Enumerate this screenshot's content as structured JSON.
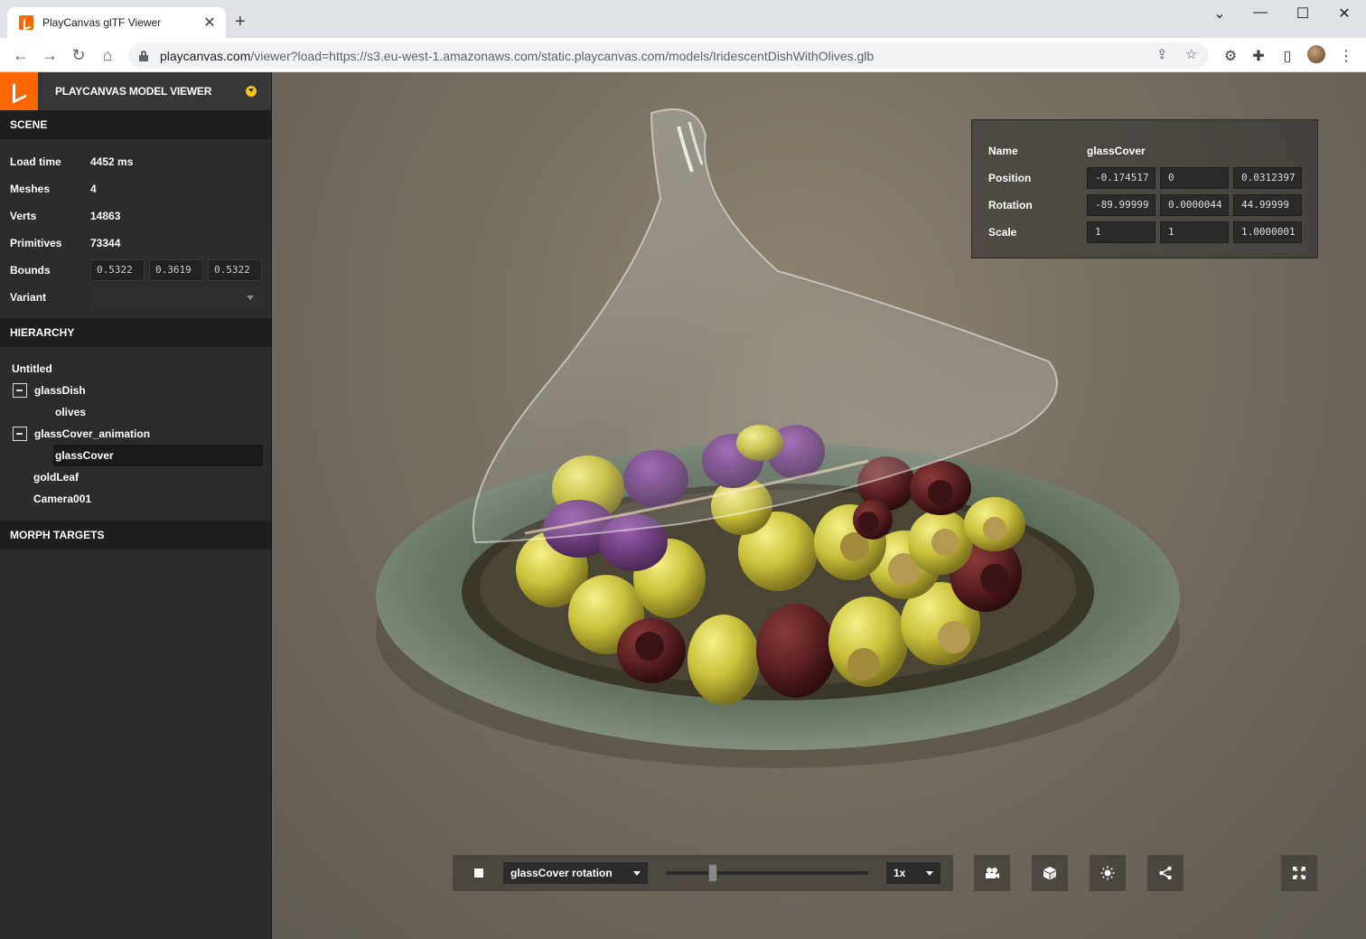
{
  "browser": {
    "tab_title": "PlayCanvas glTF Viewer",
    "tab_close": "✕",
    "new_tab": "+",
    "url_host": "playcanvas.com",
    "url_path": "/viewer?load=https://s3.eu-west-1.amazonaws.com/static.playcanvas.com/models/IridescentDishWithOlives.glb",
    "minimize": "⌄",
    "restore": "—",
    "maximize": "☐",
    "close": "✕"
  },
  "app": {
    "title": "PLAYCANVAS MODEL VIEWER",
    "accent": "#ff6600"
  },
  "scene": {
    "heading": "SCENE",
    "load_time_label": "Load time",
    "load_time": "4452 ms",
    "meshes_label": "Meshes",
    "meshes": "4",
    "verts_label": "Verts",
    "verts": "14863",
    "primitives_label": "Primitives",
    "primitives": "73344",
    "bounds_label": "Bounds",
    "bounds": [
      "0.5322",
      "0.3619",
      "0.5322"
    ],
    "variant_label": "Variant",
    "variant_value": ""
  },
  "hierarchy": {
    "heading": "HIERARCHY",
    "nodes": [
      "Untitled",
      "glassDish",
      "olives",
      "glassCover_animation",
      "glassCover",
      "goldLeaf",
      "Camera001"
    ],
    "selected": "glassCover"
  },
  "morph": {
    "heading": "MORPH TARGETS"
  },
  "inspector": {
    "name_label": "Name",
    "name": "glassCover",
    "position_label": "Position",
    "position": [
      "-0.174517",
      "0",
      "0.0312397"
    ],
    "rotation_label": "Rotation",
    "rotation": [
      "-89.99999",
      "0.0000044",
      "44.99999"
    ],
    "scale_label": "Scale",
    "scale": [
      "1",
      "1",
      "1.0000001"
    ]
  },
  "animation": {
    "track": "glassCover rotation",
    "speed": "1x",
    "progress": 0.23
  },
  "controls": {
    "camera_icon": "camera-icon",
    "model_icon": "cube-icon",
    "lighting_icon": "sun-icon",
    "share_icon": "share-icon",
    "fullscreen_icon": "fullscreen-icon"
  }
}
